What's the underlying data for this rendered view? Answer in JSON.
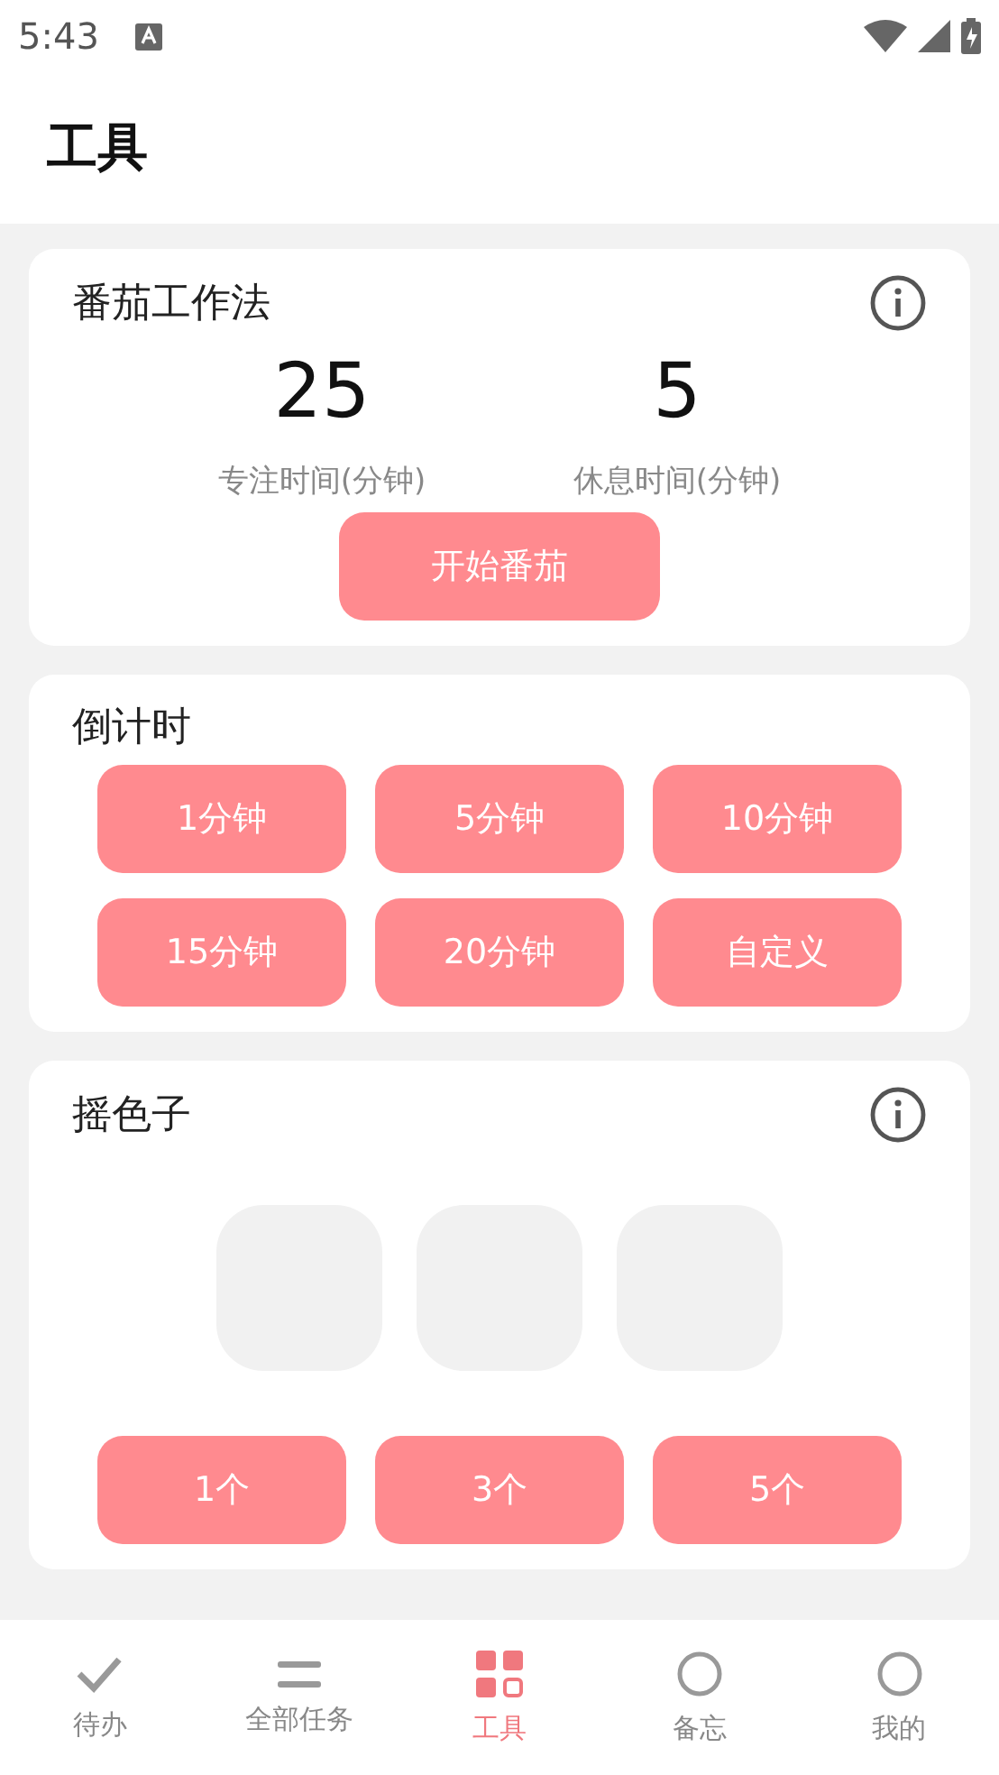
{
  "status_bar": {
    "time": "5:43"
  },
  "header": {
    "title": "工具"
  },
  "pomodoro": {
    "title": "番茄工作法",
    "stats": [
      {
        "value": "25",
        "label": "专注时间(分钟)"
      },
      {
        "value": "5",
        "label": "休息时间(分钟)"
      }
    ],
    "button": "开始番茄"
  },
  "countdown": {
    "title": "倒计时",
    "buttons": [
      "1分钟",
      "5分钟",
      "10分钟",
      "15分钟",
      "20分钟",
      "自定义"
    ]
  },
  "dice": {
    "title": "摇色子",
    "dice": [
      {
        "kind": "blank"
      },
      {
        "kind": "blank"
      },
      {
        "kind": "blank"
      }
    ],
    "buttons": [
      "1个",
      "3个",
      "5个"
    ]
  },
  "tab_bar": [
    {
      "label": "待办",
      "kind": "check",
      "selected": false
    },
    {
      "label": "全部任务",
      "kind": "list",
      "selected": false
    },
    {
      "label": "工具",
      "kind": "grid",
      "selected": true
    },
    {
      "label": "备忘",
      "kind": "circle",
      "selected": false
    },
    {
      "label": "我的",
      "kind": "circle",
      "selected": false
    }
  ]
}
